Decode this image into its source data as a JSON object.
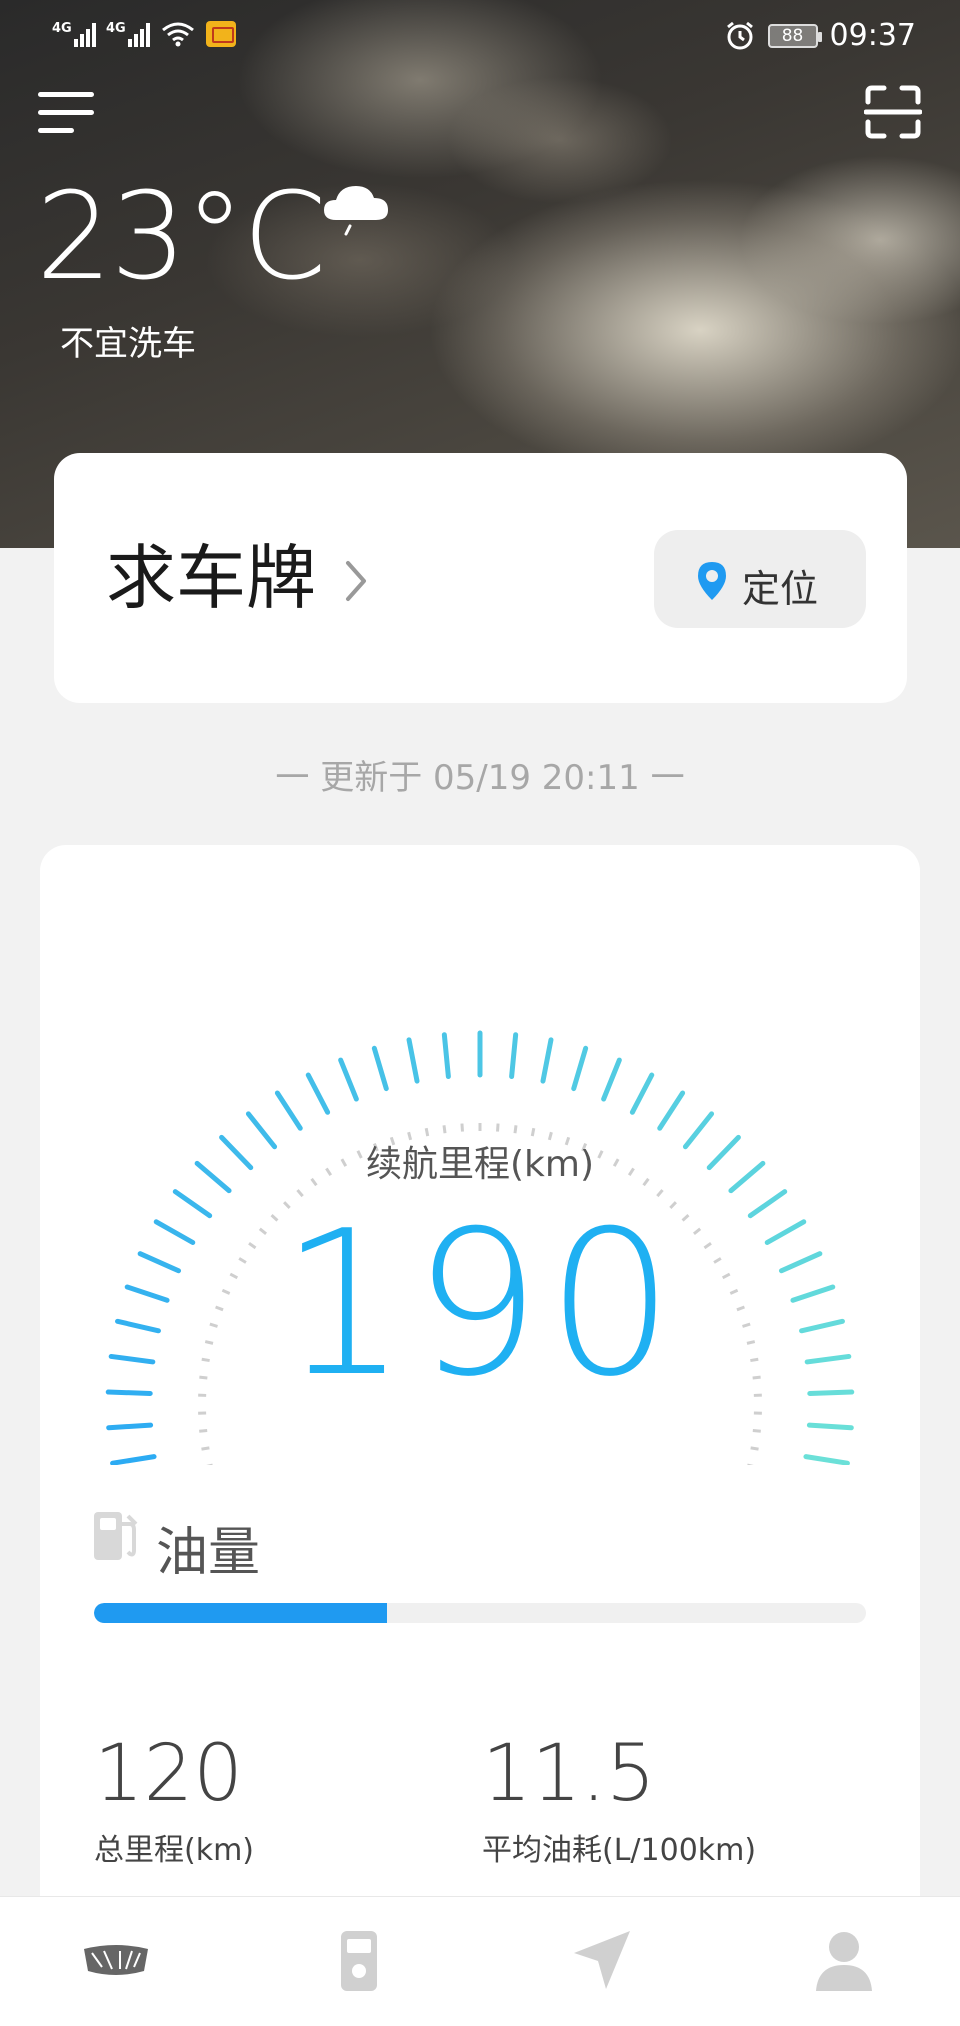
{
  "status_bar": {
    "network_1": "4G",
    "network_2": "4G",
    "battery": "88",
    "time": "09:37",
    "icons": [
      "signal-icon",
      "signal-icon",
      "wifi-icon",
      "mail-notification-icon",
      "alarm-icon",
      "battery-icon"
    ]
  },
  "weather": {
    "temperature": "23°C",
    "advice": "不宜洗车",
    "icon": "cloud-rain-icon"
  },
  "header": {
    "menu_icon": "menu-icon",
    "scan_icon": "scan-icon"
  },
  "plate_card": {
    "title": "求车牌",
    "locate_label": "定位",
    "locate_icon": "location-pin-icon"
  },
  "updated_text": "一 更新于 05/19 20:11 一",
  "range": {
    "label": "续航里程(km)",
    "value": "190"
  },
  "fuel": {
    "label": "油量",
    "level": 0.38,
    "icon": "fuel-pump-icon"
  },
  "stats": [
    {
      "value": "120",
      "caption": "总里程(km)"
    },
    {
      "value": "11.5",
      "caption": "平均油耗(L/100km)"
    }
  ],
  "tabs": [
    {
      "name": "car-home",
      "icon": "car-logo-icon"
    },
    {
      "name": "fuel",
      "icon": "fuel-station-icon"
    },
    {
      "name": "navigation",
      "icon": "navigation-arrow-icon"
    },
    {
      "name": "profile",
      "icon": "user-icon"
    }
  ],
  "colors": {
    "accent": "#1fb0f2",
    "gauge_start": "#29a8f4",
    "gauge_end": "#6ee3d6",
    "fuel_fill": "#1f9af1"
  }
}
